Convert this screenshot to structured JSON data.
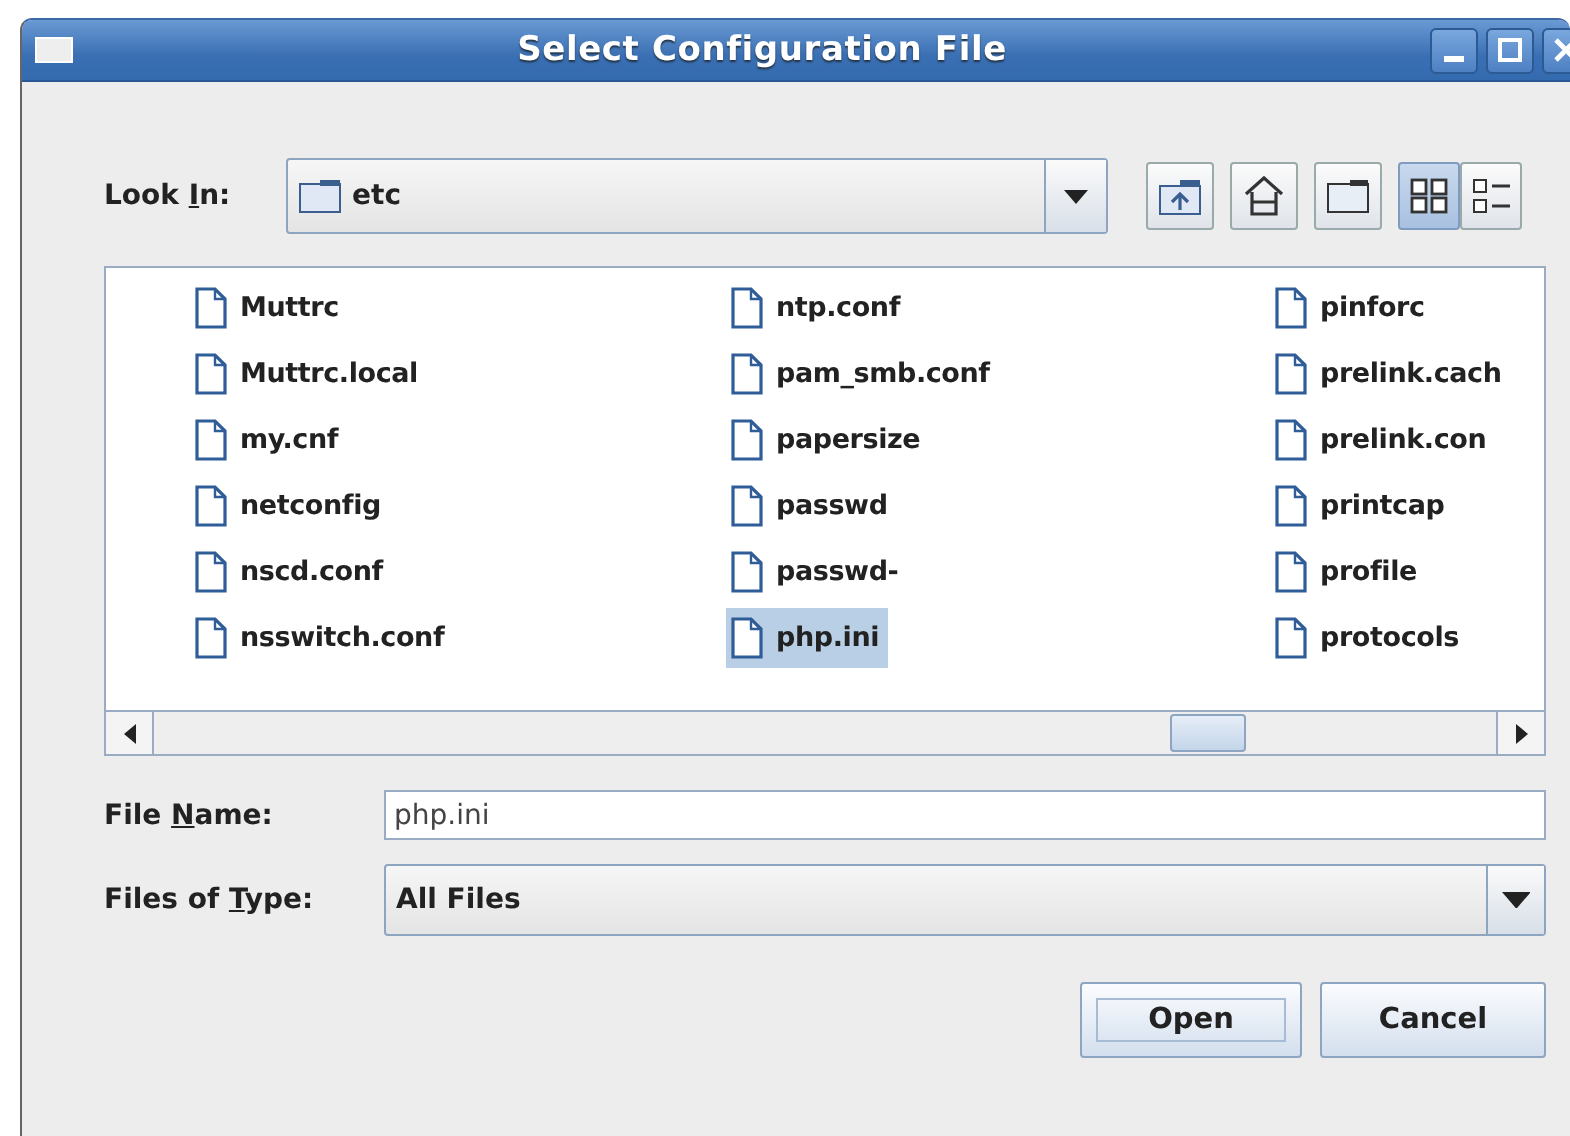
{
  "window": {
    "title": "Select Configuration File"
  },
  "look_in": {
    "label_parts": [
      "Look ",
      "I",
      "n:"
    ],
    "value": "etc"
  },
  "toolbar": [
    {
      "kind": "up",
      "selected": false
    },
    {
      "kind": "home",
      "selected": false
    },
    {
      "kind": "new-folder",
      "selected": false
    },
    {
      "kind": "list",
      "selected": true
    },
    {
      "kind": "details",
      "selected": false
    }
  ],
  "files": [
    {
      "name": "Muttrc",
      "selected": false
    },
    {
      "name": "Muttrc.local",
      "selected": false
    },
    {
      "name": "my.cnf",
      "selected": false
    },
    {
      "name": "netconfig",
      "selected": false
    },
    {
      "name": "nscd.conf",
      "selected": false
    },
    {
      "name": "nsswitch.conf",
      "selected": false
    },
    {
      "name": "ntp.conf",
      "selected": false
    },
    {
      "name": "pam_smb.conf",
      "selected": false
    },
    {
      "name": "papersize",
      "selected": false
    },
    {
      "name": "passwd",
      "selected": false
    },
    {
      "name": "passwd-",
      "selected": false
    },
    {
      "name": "php.ini",
      "selected": true
    },
    {
      "name": "pinforc",
      "selected": false
    },
    {
      "name": "prelink.cach",
      "selected": false
    },
    {
      "name": "prelink.con",
      "selected": false
    },
    {
      "name": "printcap",
      "selected": false
    },
    {
      "name": "profile",
      "selected": false
    },
    {
      "name": "protocols",
      "selected": false
    }
  ],
  "file_name": {
    "label_parts": [
      "File ",
      "N",
      "ame:"
    ],
    "value": "php.ini"
  },
  "files_of_type": {
    "label_parts": [
      "Files of ",
      "T",
      "ype:"
    ],
    "value": "All Files"
  },
  "buttons": [
    {
      "label": "Open",
      "kind": "default"
    },
    {
      "label": "Cancel",
      "kind": "normal"
    }
  ]
}
